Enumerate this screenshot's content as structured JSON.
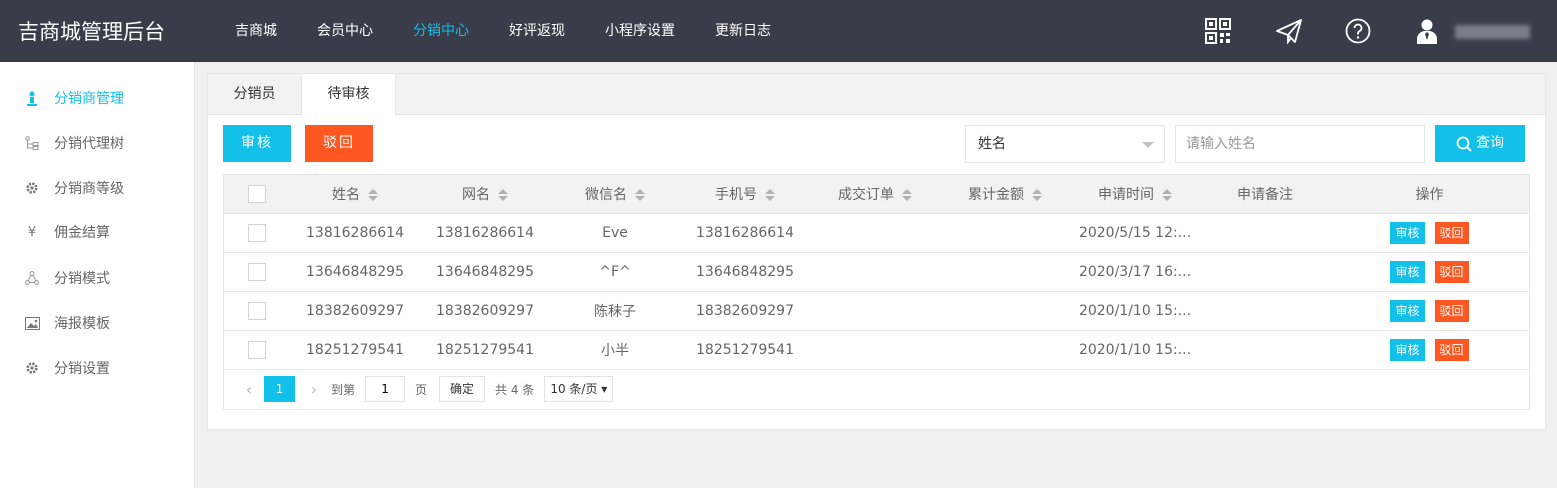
{
  "app": {
    "title": "吉商城管理后台"
  },
  "nav": [
    {
      "label": "吉商城",
      "active": false
    },
    {
      "label": "会员中心",
      "active": false
    },
    {
      "label": "分销中心",
      "active": true
    },
    {
      "label": "好评返现",
      "active": false
    },
    {
      "label": "小程序设置",
      "active": false
    },
    {
      "label": "更新日志",
      "active": false
    }
  ],
  "header_icons": [
    "qrcode-icon",
    "send-icon",
    "help-icon",
    "user-icon"
  ],
  "sidebar": [
    {
      "label": "分销商管理",
      "icon": "person-icon",
      "active": true
    },
    {
      "label": "分销代理树",
      "icon": "tree-icon",
      "active": false
    },
    {
      "label": "分销商等级",
      "icon": "gear-icon",
      "active": false
    },
    {
      "label": "佣金结算",
      "icon": "yen-icon",
      "active": false
    },
    {
      "label": "分销模式",
      "icon": "network-icon",
      "active": false
    },
    {
      "label": "海报模板",
      "icon": "image-icon",
      "active": false
    },
    {
      "label": "分销设置",
      "icon": "gear-icon",
      "active": false
    }
  ],
  "tabs": [
    {
      "label": "分销员",
      "active": false
    },
    {
      "label": "待审核",
      "active": true
    }
  ],
  "toolbar": {
    "audit_label": "审核",
    "reject_label": "驳回",
    "filter_value": "姓名",
    "search_placeholder": "请输入姓名",
    "search_label": "查询"
  },
  "table": {
    "columns": [
      "姓名",
      "网名",
      "微信名",
      "手机号",
      "成交订单",
      "累计金额",
      "申请时间",
      "申请备注",
      "操作"
    ],
    "rows": [
      {
        "name": "13816286614",
        "nick": "13816286614",
        "wechat": "Eve",
        "phone": "13816286614",
        "orders": "",
        "amount": "",
        "time": "2020/5/15 12:...",
        "note": ""
      },
      {
        "name": "13646848295",
        "nick": "13646848295",
        "wechat": "^F^",
        "phone": "13646848295",
        "orders": "",
        "amount": "",
        "time": "2020/3/17 16:...",
        "note": ""
      },
      {
        "name": "18382609297",
        "nick": "18382609297",
        "wechat": "陈秣子",
        "phone": "18382609297",
        "orders": "",
        "amount": "",
        "time": "2020/1/10 15:...",
        "note": ""
      },
      {
        "name": "18251279541",
        "nick": "18251279541",
        "wechat": "小半",
        "phone": "18251279541",
        "orders": "",
        "amount": "",
        "time": "2020/1/10 15:...",
        "note": ""
      }
    ],
    "row_actions": {
      "audit": "审核",
      "reject": "驳回"
    }
  },
  "pager": {
    "current": "1",
    "goto_label": "到第",
    "goto_value": "1",
    "page_unit": "页",
    "confirm_label": "确定",
    "total_text": "共 4 条",
    "page_size": "10 条/页"
  },
  "colors": {
    "accent": "#13c0e9",
    "danger": "#ff5722",
    "header_bg": "#393d49"
  }
}
